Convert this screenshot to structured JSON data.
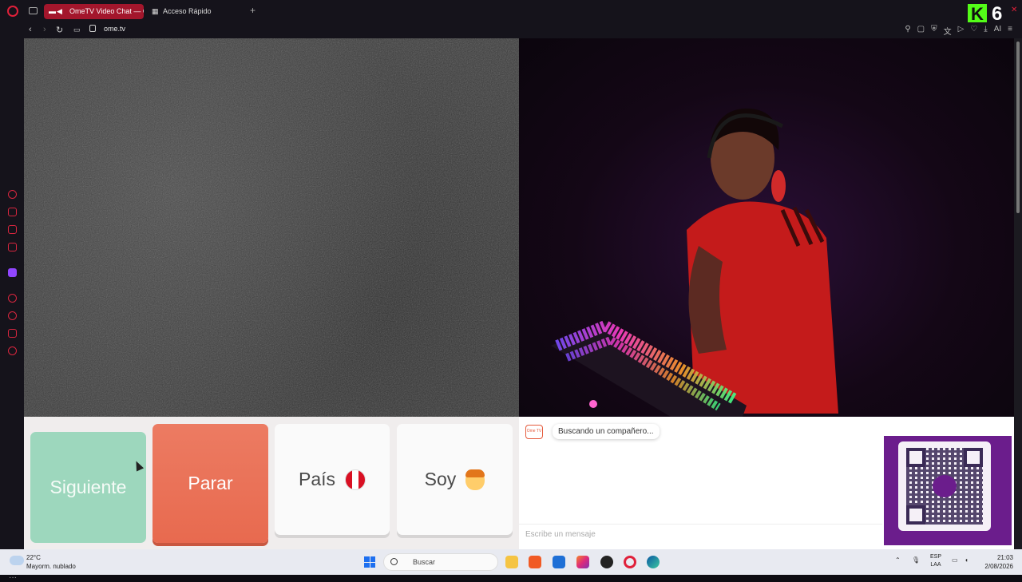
{
  "browser": {
    "active_tab": "OmeTV Video Chat — O",
    "other_tab": "Acceso Rápido",
    "new_tab": "+",
    "url": "ome.tv",
    "badge_k": "K",
    "badge_six": "6",
    "ai_label": "AI"
  },
  "controls": {
    "next_label": "Siguiente",
    "stop_label": "Parar",
    "country_label": "País",
    "iam_label": "Soy"
  },
  "chat": {
    "logo_text": "Ome TV",
    "status_message": "Buscando un compañero...",
    "input_placeholder": "Escribe un mensaje"
  },
  "taskbar": {
    "temperature": "22°C",
    "weather": "Mayorm. nublado",
    "search_placeholder": "Buscar",
    "lang_top": "ESP",
    "lang_bottom": "LAA",
    "time": "21:03",
    "date": "2/08/2026"
  },
  "colors": {
    "accent": "#a3162c",
    "next": "#9dd7bd",
    "stop": "#e86a4f",
    "qr_bg": "#6b1d8c"
  }
}
